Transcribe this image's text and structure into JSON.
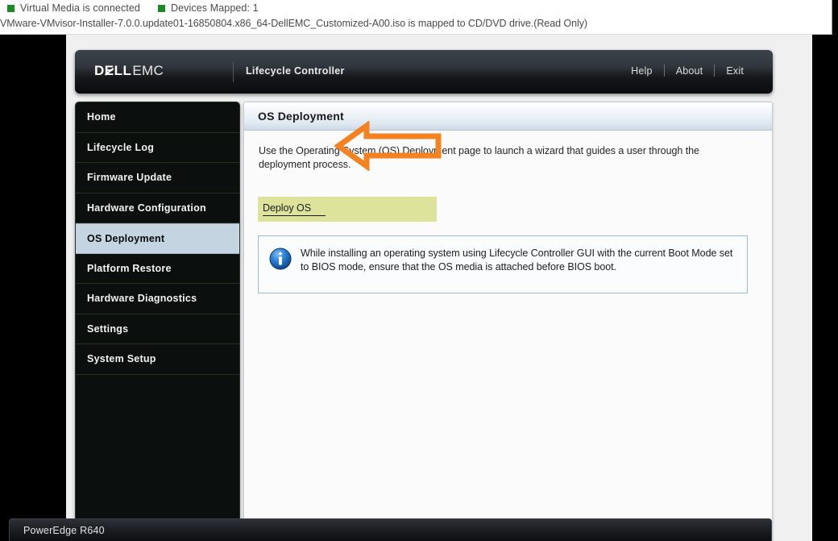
{
  "virtual_media_banner": {
    "status_1": "Virtual Media is connected",
    "status_2": "Devices Mapped: 1",
    "mapped_media": "VMware-VMvisor-Installer-7.0.0.update01-16850804.x86_64-DellEMC_Customized-A00.iso is mapped to CD/DVD drive.(Read Only)",
    "marker_color": "#1a8a22"
  },
  "header": {
    "brand_dell": "DELL",
    "brand_emc": "EMC",
    "app_title": "Lifecycle Controller",
    "links": [
      {
        "label": "Help"
      },
      {
        "label": "About"
      },
      {
        "label": "Exit"
      }
    ]
  },
  "sidebar": {
    "items": [
      {
        "label": "Home",
        "selected": false
      },
      {
        "label": "Lifecycle Log",
        "selected": false
      },
      {
        "label": "Firmware Update",
        "selected": false
      },
      {
        "label": "Hardware Configuration",
        "selected": false
      },
      {
        "label": "OS Deployment",
        "selected": true
      },
      {
        "label": "Platform Restore",
        "selected": false
      },
      {
        "label": "Hardware Diagnostics",
        "selected": false
      },
      {
        "label": "Settings",
        "selected": false
      },
      {
        "label": "System Setup",
        "selected": false
      }
    ],
    "selected_bg": "#c4d4e1"
  },
  "content": {
    "panel_title": "OS Deployment",
    "intro": "Use the Operating System (OS) Deployment page to launch a wizard that guides a user through the deployment process.",
    "deploy_link": "Deploy OS",
    "highlight_color": "#dee39b",
    "annotation": {
      "shape": "left-arrow",
      "color": "#f58220"
    },
    "info": {
      "icon": "info-icon",
      "text": "While installing an operating system using Lifecycle Controller GUI with the current Boot Mode set to BIOS mode, ensure that the OS media is attached before BIOS boot."
    }
  },
  "status_bar": {
    "model": "PowerEdge R640"
  }
}
